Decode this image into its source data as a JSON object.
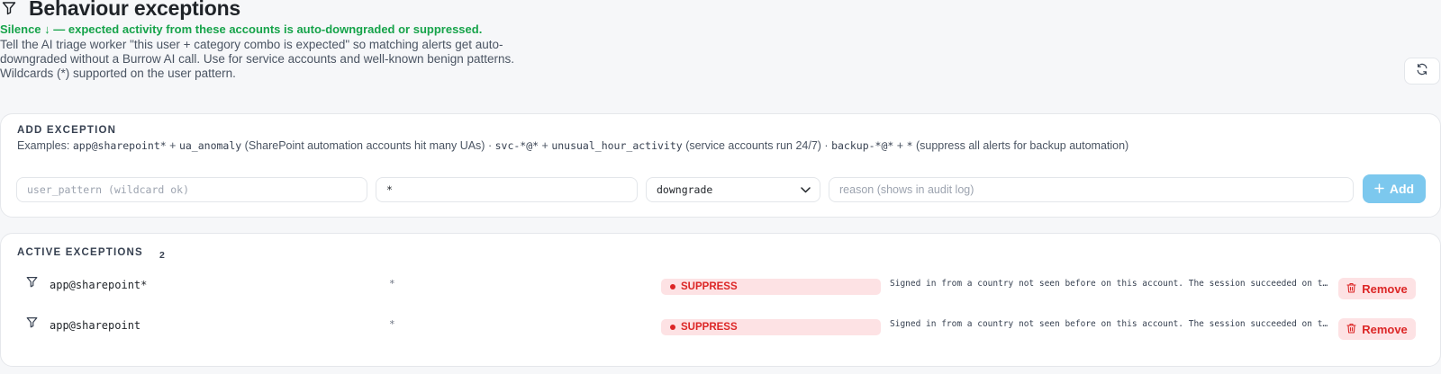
{
  "header": {
    "title": "Behaviour exceptions",
    "icon": "filter-icon",
    "silence_line": "Silence ↓ — expected activity from these accounts is auto-downgraded or suppressed.",
    "description_lines": [
      "Tell the AI triage worker \"this user + category combo is expected\" so matching alerts get auto-",
      "downgraded without a Burrow AI call. Use for service accounts and well-known benign patterns.",
      "Wildcards (*) supported on the user pattern."
    ]
  },
  "refresh": {
    "icon": "refresh-icon"
  },
  "add_exception": {
    "label": "ADD EXCEPTION",
    "examples": {
      "prefix": "Examples: ",
      "ex1_user": "app@sharepoint*",
      "ex1_plus": " + ",
      "ex1_cat": "ua_anomaly",
      "ex1_note": " (SharePoint automation accounts hit many UAs) · ",
      "ex2_user": "svc-*@*",
      "ex2_plus": " + ",
      "ex2_cat": "unusual_hour_activity",
      "ex2_note": " (service accounts run 24/7) · ",
      "ex3_user": "backup-*@*",
      "ex3_plus": " + ",
      "ex3_cat": "*",
      "ex3_note": " (suppress all alerts for backup automation)"
    },
    "user_pattern_placeholder": "user_pattern (wildcard ok)",
    "category_value": "*",
    "action_selected": "downgrade",
    "reason_placeholder": "reason (shows in audit log)",
    "add_label": "Add",
    "accent_color": "#7cc8ee"
  },
  "active": {
    "label": "ACTIVE EXCEPTIONS",
    "count": "2",
    "rows": [
      {
        "user": "app@sharepoint*",
        "category": "*",
        "action": "SUPPRESS",
        "reason": "Signed in from a country not seen before on this account. The session succeeded on the first attempt",
        "remove_label": "Remove"
      },
      {
        "user": "app@sharepoint",
        "category": "*",
        "action": "SUPPRESS",
        "reason": "Signed in from a country not seen before on this account. The session succeeded on the first attempt",
        "remove_label": "Remove"
      }
    ]
  },
  "colors": {
    "silence_green": "#16a34a",
    "suppress_red": "#dc2626",
    "suppress_bg": "#fde2e4"
  }
}
